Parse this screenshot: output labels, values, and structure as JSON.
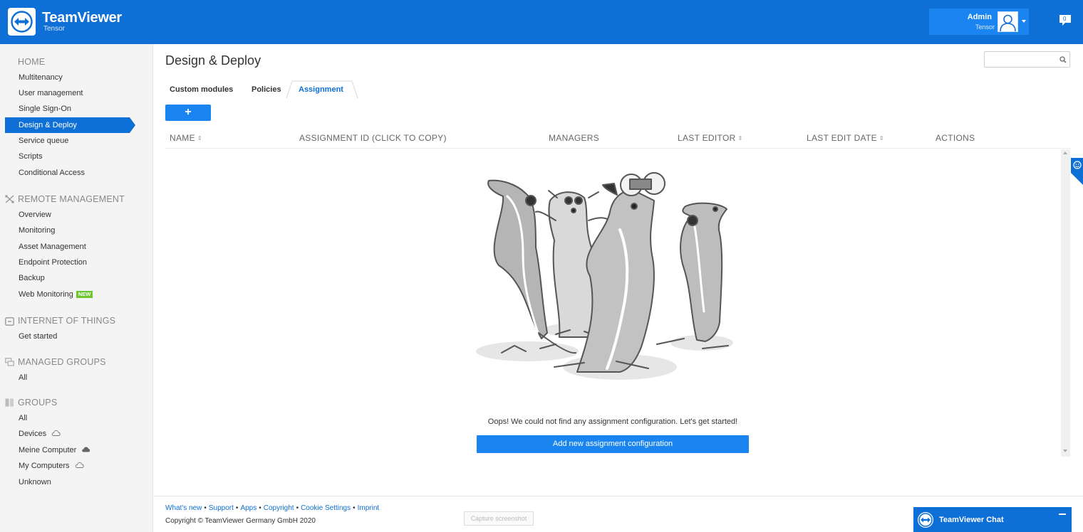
{
  "header": {
    "brand": "TeamViewer",
    "brand_sub": "Tensor",
    "user_name": "Admin",
    "user_org": "Tensor",
    "notifications_count": "0"
  },
  "sidebar": {
    "home": {
      "title": "HOME",
      "items": [
        "Multitenancy",
        "User management",
        "Single Sign-On",
        "Design & Deploy",
        "Service queue",
        "Scripts",
        "Conditional Access"
      ],
      "active": "Design & Deploy"
    },
    "remote": {
      "title": "REMOTE MANAGEMENT",
      "items": [
        "Overview",
        "Monitoring",
        "Asset Management",
        "Endpoint Protection",
        "Backup",
        "Web Monitoring"
      ],
      "new_badge": "NEW"
    },
    "iot": {
      "title": "INTERNET OF THINGS",
      "items": [
        "Get started"
      ]
    },
    "managed": {
      "title": "MANAGED GROUPS",
      "items": [
        "All"
      ]
    },
    "groups": {
      "title": "GROUPS",
      "items": [
        "All",
        "Devices",
        "Meine Computer",
        "My Computers",
        "Unknown"
      ]
    }
  },
  "main": {
    "title": "Design & Deploy",
    "search_placeholder": "",
    "tabs": [
      "Custom modules",
      "Policies",
      "Assignment"
    ],
    "active_tab": "Assignment",
    "add_button": "+",
    "columns": [
      "NAME",
      "ASSIGNMENT ID (CLICK TO COPY)",
      "MANAGERS",
      "LAST EDITOR",
      "LAST EDIT DATE",
      "ACTIONS"
    ],
    "empty_message": "Oops! We could not find any assignment configuration. Let's get started!",
    "cta": "Add new assignment configuration"
  },
  "footer": {
    "links": [
      "What's new",
      "Support",
      "Apps",
      "Copyright",
      "Cookie Settings",
      "Imprint"
    ],
    "copyright": "Copyright © TeamViewer Germany GmbH 2020",
    "capture": "Capture screenshot",
    "chat": "TeamViewer Chat"
  },
  "colors": {
    "brand_blue": "#0e6fd6",
    "button_blue": "#1a85f0",
    "new_badge": "#6cc72f"
  }
}
